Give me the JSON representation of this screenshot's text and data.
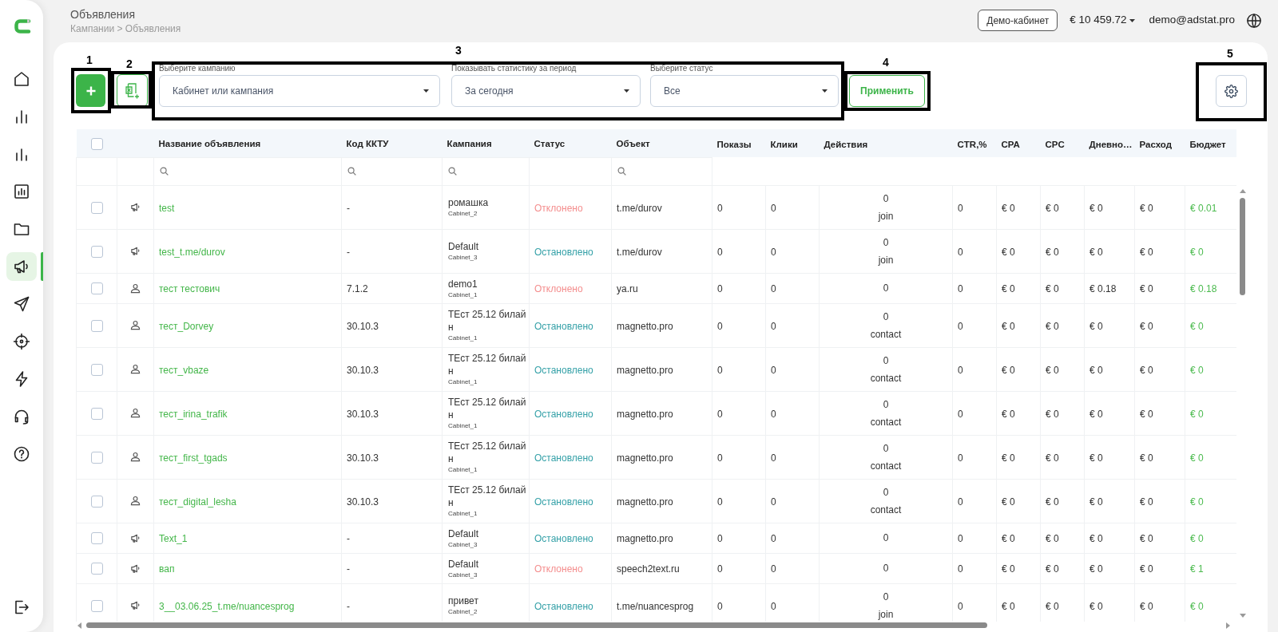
{
  "sidebar": {
    "items": [
      {
        "kind": "home",
        "selected": false
      },
      {
        "kind": "stats",
        "selected": false
      },
      {
        "kind": "stats-alt",
        "selected": false
      },
      {
        "kind": "report",
        "selected": false
      },
      {
        "kind": "folder",
        "selected": false
      },
      {
        "kind": "megaphone",
        "selected": true
      },
      {
        "kind": "send",
        "selected": false
      },
      {
        "kind": "target",
        "selected": false
      },
      {
        "kind": "bolt",
        "selected": false
      },
      {
        "kind": "headset",
        "selected": false
      },
      {
        "kind": "help",
        "selected": false
      }
    ],
    "bottom_items": [
      {
        "kind": "logout"
      }
    ]
  },
  "header": {
    "title": "Объявления",
    "breadcrumb": "Кампании > Объявления",
    "account_button": "Демо-кабинет",
    "balance": "€ 10 459.72",
    "email": "demo@adstat.pro"
  },
  "toolbar": {
    "filters": [
      {
        "label": "Выберите кампанию",
        "value": "Кабинет или кампания"
      },
      {
        "label": "Показывать статистику за период",
        "value": "За сегодня"
      },
      {
        "label": "Выберите статус",
        "value": "Все"
      }
    ],
    "apply_button": "Применить"
  },
  "table": {
    "select_all": {
      "checked": false
    },
    "columns": [
      {
        "label": "Название объявления",
        "filter": true
      },
      {
        "label": "Код ККТУ",
        "filter": true
      },
      {
        "label": "Кампания",
        "filter": true
      },
      {
        "label": "Статус",
        "filter": false
      },
      {
        "label": "Объект",
        "filter": true
      },
      {
        "label": "Показы",
        "filter": false
      },
      {
        "label": "Клики",
        "filter": false
      },
      {
        "label": "Действия",
        "filter": false
      },
      {
        "label": "CTR,%",
        "filter": false
      },
      {
        "label": "CPA",
        "filter": false
      },
      {
        "label": "CPC",
        "filter": false
      },
      {
        "label": "Дневно…",
        "filter": false
      },
      {
        "label": "Расход",
        "filter": false
      },
      {
        "label": "Бюджет",
        "filter": false
      }
    ],
    "rows": [
      {
        "kind": "megaphone",
        "checked": false,
        "name": "test",
        "code": "-",
        "campaign": "ромашка",
        "cabinet": "Cabinet_2",
        "status": {
          "label": "Отклонено",
          "kind": "rejected"
        },
        "object": "t.me/durov",
        "shows": "0",
        "clicks": "0",
        "actions": {
          "count": "0",
          "type": "join"
        },
        "ctr": "0",
        "cpa": "€ 0",
        "cpc": "€ 0",
        "daily": "€ 0",
        "spend": "€ 0",
        "budget": "€ 0.01"
      },
      {
        "kind": "megaphone",
        "checked": false,
        "name": "test_t.me/durov",
        "code": "-",
        "campaign": "Default",
        "cabinet": "Cabinet_3",
        "status": {
          "label": "Остановлено",
          "kind": "stopped"
        },
        "object": "t.me/durov",
        "shows": "0",
        "clicks": "0",
        "actions": {
          "count": "0",
          "type": "join"
        },
        "ctr": "0",
        "cpa": "€ 0",
        "cpc": "€ 0",
        "daily": "€ 0",
        "spend": "€ 0",
        "budget": "€ 0"
      },
      {
        "kind": "person",
        "checked": false,
        "name": "тест тестович",
        "code": "7.1.2",
        "campaign": "demo1",
        "cabinet": "Cabinet_1",
        "status": {
          "label": "Отклонено",
          "kind": "rejected"
        },
        "object": "ya.ru",
        "shows": "0",
        "clicks": "0",
        "actions": {
          "count": "0"
        },
        "ctr": "0",
        "cpa": "€ 0",
        "cpc": "€ 0",
        "daily": "€ 0.18",
        "spend": "€ 0",
        "budget": "€ 0.18"
      },
      {
        "kind": "person",
        "checked": false,
        "name": "тест_Dorvey",
        "code": "30.10.3",
        "campaign": "ТЕст 25.12 билайн",
        "cabinet": "Cabinet_1",
        "status": {
          "label": "Остановлено",
          "kind": "stopped"
        },
        "object": "magnetto.pro",
        "shows": "0",
        "clicks": "0",
        "actions": {
          "count": "0",
          "type": "contact"
        },
        "ctr": "0",
        "cpa": "€ 0",
        "cpc": "€ 0",
        "daily": "€ 0",
        "spend": "€ 0",
        "budget": "€ 0"
      },
      {
        "kind": "person",
        "checked": false,
        "name": "тест_vbaze",
        "code": "30.10.3",
        "campaign": "ТЕст 25.12 билайн",
        "cabinet": "Cabinet_1",
        "status": {
          "label": "Остановлено",
          "kind": "stopped"
        },
        "object": "magnetto.pro",
        "shows": "0",
        "clicks": "0",
        "actions": {
          "count": "0",
          "type": "contact"
        },
        "ctr": "0",
        "cpa": "€ 0",
        "cpc": "€ 0",
        "daily": "€ 0",
        "spend": "€ 0",
        "budget": "€ 0"
      },
      {
        "kind": "person",
        "checked": false,
        "name": "тест_irina_trafik",
        "code": "30.10.3",
        "campaign": "ТЕст 25.12 билайн",
        "cabinet": "Cabinet_1",
        "status": {
          "label": "Остановлено",
          "kind": "stopped"
        },
        "object": "magnetto.pro",
        "shows": "0",
        "clicks": "0",
        "actions": {
          "count": "0",
          "type": "contact"
        },
        "ctr": "0",
        "cpa": "€ 0",
        "cpc": "€ 0",
        "daily": "€ 0",
        "spend": "€ 0",
        "budget": "€ 0"
      },
      {
        "kind": "person",
        "checked": false,
        "name": "тест_first_tgads",
        "code": "30.10.3",
        "campaign": "ТЕст 25.12 билайн",
        "cabinet": "Cabinet_1",
        "status": {
          "label": "Остановлено",
          "kind": "stopped"
        },
        "object": "magnetto.pro",
        "shows": "0",
        "clicks": "0",
        "actions": {
          "count": "0",
          "type": "contact"
        },
        "ctr": "0",
        "cpa": "€ 0",
        "cpc": "€ 0",
        "daily": "€ 0",
        "spend": "€ 0",
        "budget": "€ 0"
      },
      {
        "kind": "person",
        "checked": false,
        "name": "тест_digital_lesha",
        "code": "30.10.3",
        "campaign": "ТЕст 25.12 билайн",
        "cabinet": "Cabinet_1",
        "status": {
          "label": "Остановлено",
          "kind": "stopped"
        },
        "object": "magnetto.pro",
        "shows": "0",
        "clicks": "0",
        "actions": {
          "count": "0",
          "type": "contact"
        },
        "ctr": "0",
        "cpa": "€ 0",
        "cpc": "€ 0",
        "daily": "€ 0",
        "spend": "€ 0",
        "budget": "€ 0"
      },
      {
        "kind": "megaphone",
        "checked": false,
        "name": "Text_1",
        "code": "-",
        "campaign": "Default",
        "cabinet": "Cabinet_3",
        "status": {
          "label": "Остановлено",
          "kind": "stopped"
        },
        "object": "magnetto.pro",
        "shows": "0",
        "clicks": "0",
        "actions": {
          "count": "0"
        },
        "ctr": "0",
        "cpa": "€ 0",
        "cpc": "€ 0",
        "daily": "€ 0",
        "spend": "€ 0",
        "budget": "€ 0"
      },
      {
        "kind": "megaphone",
        "checked": false,
        "name": "вап",
        "code": "-",
        "campaign": "Default",
        "cabinet": "Cabinet_3",
        "status": {
          "label": "Отклонено",
          "kind": "rejected"
        },
        "object": "speech2text.ru",
        "shows": "0",
        "clicks": "0",
        "actions": {
          "count": "0"
        },
        "ctr": "0",
        "cpa": "€ 0",
        "cpc": "€ 0",
        "daily": "€ 0",
        "spend": "€ 0",
        "budget": "€ 1"
      },
      {
        "kind": "megaphone",
        "checked": false,
        "name": "3__03.06.25_t.me/nuancesprog",
        "code": "-",
        "campaign": "привет",
        "cabinet": "Cabinet_2",
        "status": {
          "label": "Остановлено",
          "kind": "stopped"
        },
        "object": "t.me/nuancesprog",
        "shows": "0",
        "clicks": "0",
        "actions": {
          "count": "0",
          "type": "join"
        },
        "ctr": "0",
        "cpa": "€ 0",
        "cpc": "€ 0",
        "daily": "€ 0",
        "spend": "€ 0",
        "budget": "€ 0"
      }
    ]
  },
  "annotations": [
    {
      "label": "1"
    },
    {
      "label": "2"
    },
    {
      "label": "3"
    },
    {
      "label": "4"
    },
    {
      "label": "5"
    }
  ]
}
